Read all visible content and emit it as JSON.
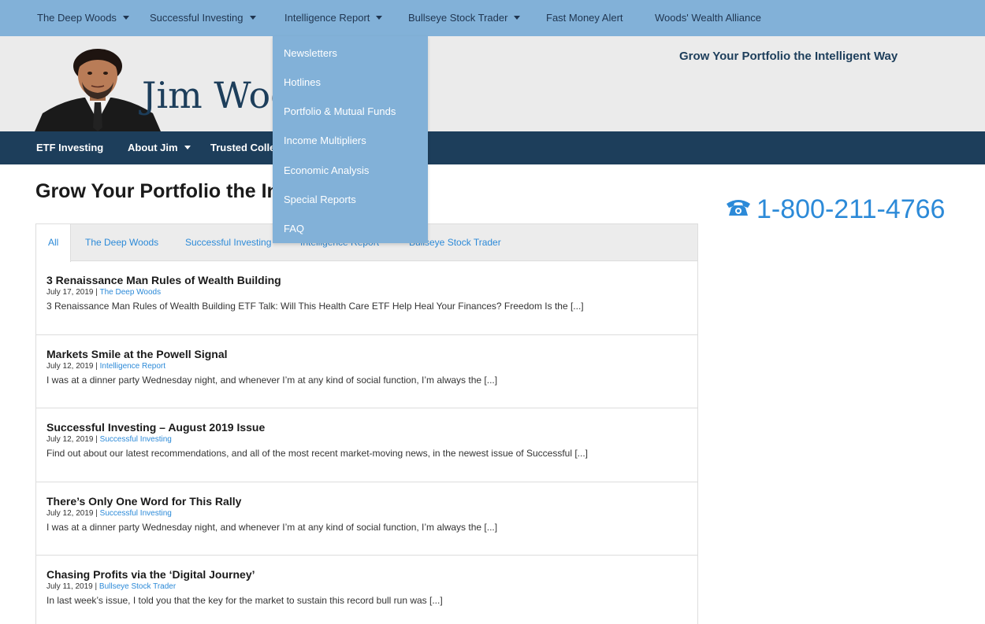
{
  "topnav": {
    "items": [
      {
        "label": "The Deep Woods",
        "has_caret": true
      },
      {
        "label": "Successful Investing",
        "has_caret": true
      },
      {
        "label": "Intelligence Report",
        "has_caret": true
      },
      {
        "label": "Bullseye Stock Trader",
        "has_caret": true
      },
      {
        "label": "Fast Money Alert",
        "has_caret": false
      },
      {
        "label": "Woods' Wealth Alliance",
        "has_caret": false
      }
    ]
  },
  "dropdown": {
    "items": [
      {
        "label": "Newsletters"
      },
      {
        "label": "Hotlines"
      },
      {
        "label": "Portfolio & Mutual Funds"
      },
      {
        "label": "Income Multipliers"
      },
      {
        "label": "Economic Analysis"
      },
      {
        "label": "Special Reports"
      },
      {
        "label": "FAQ"
      }
    ]
  },
  "header": {
    "brand": "Jim Woods",
    "tagline": "Grow Your Portfolio the Intelligent Way"
  },
  "subnav": {
    "items": [
      {
        "label": "ETF Investing",
        "has_caret": false
      },
      {
        "label": "About Jim",
        "has_caret": true
      },
      {
        "label": "Trusted Colleagues",
        "has_caret": false
      }
    ]
  },
  "main": {
    "title": "Grow Your Portfolio the Intelligent Way",
    "phone": "1-800-211-4766",
    "tabs": [
      {
        "label": "All",
        "active": true
      },
      {
        "label": "The Deep Woods"
      },
      {
        "label": "Successful Investing"
      },
      {
        "label": "Intelligence Report"
      },
      {
        "label": "Bullseye Stock Trader"
      }
    ],
    "articles": [
      {
        "title": "3 Renaissance Man Rules of Wealth Building",
        "date": "July 17, 2019",
        "category": "The Deep Woods",
        "excerpt": "3 Renaissance Man Rules of Wealth Building ETF Talk: Will This Health Care ETF Help Heal Your Finances? Freedom Is the [...]"
      },
      {
        "title": "Markets Smile at the Powell Signal",
        "date": "July 12, 2019",
        "category": "Intelligence Report",
        "excerpt": "I was at a dinner party Wednesday night, and whenever I’m at any kind of social function, I’m always the [...]"
      },
      {
        "title": "Successful Investing – August 2019 Issue",
        "date": "July 12, 2019",
        "category": "Successful Investing",
        "excerpt": "Find out about our latest recommendations, and all of the most recent market-moving news, in the newest issue of Successful [...]"
      },
      {
        "title": "There’s Only One Word for This Rally",
        "date": "July 12, 2019",
        "category": "Successful Investing",
        "excerpt": "I was at a dinner party Wednesday night, and whenever I’m at any kind of social function, I’m always the [...]"
      },
      {
        "title": "Chasing Profits via the ‘Digital Journey’",
        "date": "July 11, 2019",
        "category": "Bullseye Stock Trader",
        "excerpt": "In last week’s issue, I told you that the key for the market to sustain this record bull run was [...]"
      }
    ]
  },
  "colors": {
    "topnav_bg": "#82b1d8",
    "subnav_bg": "#1d3e5b",
    "header_bg": "#ebebeb",
    "accent_blue": "#2c8ad8"
  }
}
